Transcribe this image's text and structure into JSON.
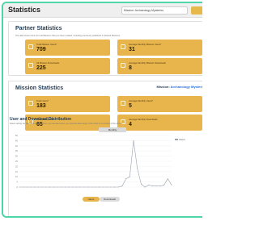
{
  "app": {
    "title": "Statistics",
    "mission_select": "Mission: Archaeology Mysteries",
    "colors": {
      "accent": "#e8b44c",
      "title": "#1f3a57",
      "frame": "#4fd6a6"
    }
  },
  "partner": {
    "title": "Partner Statistics",
    "description": "The data shown here from all Missions that you have created, including previously published or deleted Missions.",
    "cards": [
      {
        "label": "Total Mission Users*",
        "value": "709"
      },
      {
        "label": "Average Monthly Mission Users*",
        "value": "31"
      },
      {
        "label": "All Mission Downloads",
        "value": "225"
      },
      {
        "label": "Average Monthly Mission Downloads",
        "value": "8"
      }
    ]
  },
  "mission": {
    "title": "Mission Statistics",
    "mission_prefix": "Mission:",
    "mission_name": "Archaeology Mysteri",
    "cards": [
      {
        "label": "Total Users*",
        "value": "183"
      },
      {
        "label": "Average Monthly Users*",
        "value": "5"
      },
      {
        "label": "Total Downloads",
        "value": "65"
      },
      {
        "label": "Average Monthly Downloads",
        "value": "4"
      }
    ]
  },
  "chart": {
    "title": "User and Download Distribution",
    "description": "Select setting the date tabs/toggle to here, you can also hover you view the date range of the chart for a number of the partner.",
    "tab": "Monthly",
    "toggles": {
      "users": "Users",
      "downloads": "Downloads"
    },
    "legend": "Users"
  },
  "chart_data": {
    "type": "line",
    "title": "User and Download Distribution",
    "series": [
      {
        "name": "Users",
        "color": "#9aa3b0",
        "values": [
          0,
          0,
          0,
          0,
          0,
          0,
          0,
          0,
          0,
          0,
          0,
          0,
          0,
          0,
          0,
          0,
          0,
          0,
          0,
          0,
          0,
          0,
          0,
          0,
          0,
          0,
          0,
          1,
          8,
          10,
          45,
          18,
          3,
          0,
          2,
          1,
          1,
          1,
          2,
          8,
          2
        ]
      }
    ],
    "ylim": [
      0,
      50
    ],
    "yticks": [
      "50",
      "45",
      "40",
      "35",
      "30",
      "25",
      "20",
      "15",
      "10",
      "5",
      "0"
    ],
    "grid": true,
    "legend_position": "top-right"
  }
}
